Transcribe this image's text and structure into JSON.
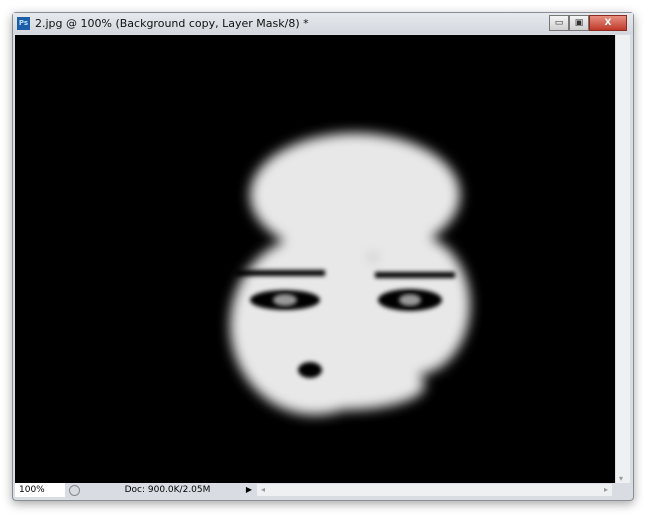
{
  "window": {
    "title": "2.jpg @ 100% (Background copy, Layer Mask/8) *",
    "app_icon": "Ps"
  },
  "controls": {
    "minimize": "▭",
    "maximize": "▣",
    "close": "X"
  },
  "status": {
    "zoom": "100%",
    "doc": "Doc: 900.0K/2.05M",
    "menu_arrow": "▶"
  },
  "scroll": {
    "left": "◂",
    "right": "▸",
    "down": "▾"
  }
}
